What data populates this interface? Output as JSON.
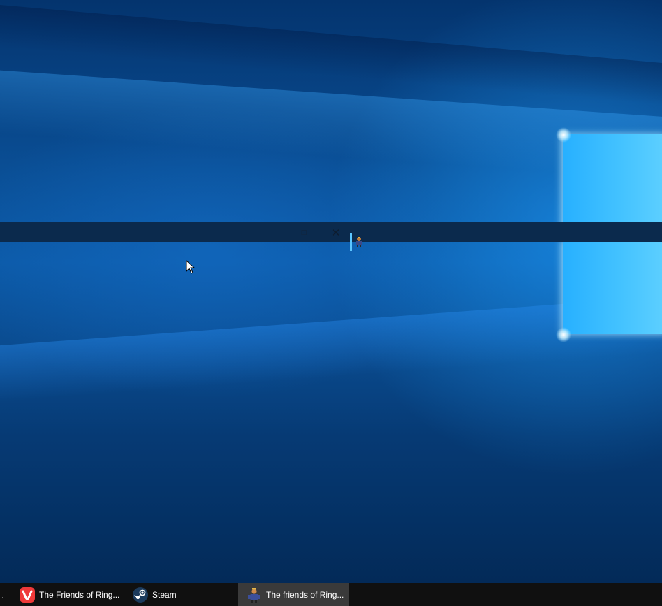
{
  "desktop": {
    "wallpaper": "windows-10-hero-blue",
    "colors": {
      "primary_blue": "#0c5aa8",
      "light_pane": "#46c4ff",
      "dark_blue": "#032a58"
    }
  },
  "floating_window": {
    "minimize_glyph": "–",
    "maximize_glyph": "□",
    "close_glyph": "✕",
    "icon": "game-character-icon"
  },
  "taskbar": {
    "overflow_glyph": ".",
    "items": [
      {
        "label": "The Friends of Ring...",
        "icon": "vivaldi-icon",
        "active": false
      },
      {
        "label": "Steam",
        "icon": "steam-icon",
        "active": false
      },
      {
        "label": "The friends of Ring...",
        "icon": "game-character-icon",
        "active": true
      }
    ],
    "colors": {
      "background": "#101010",
      "active": "#3a3a3a"
    }
  }
}
